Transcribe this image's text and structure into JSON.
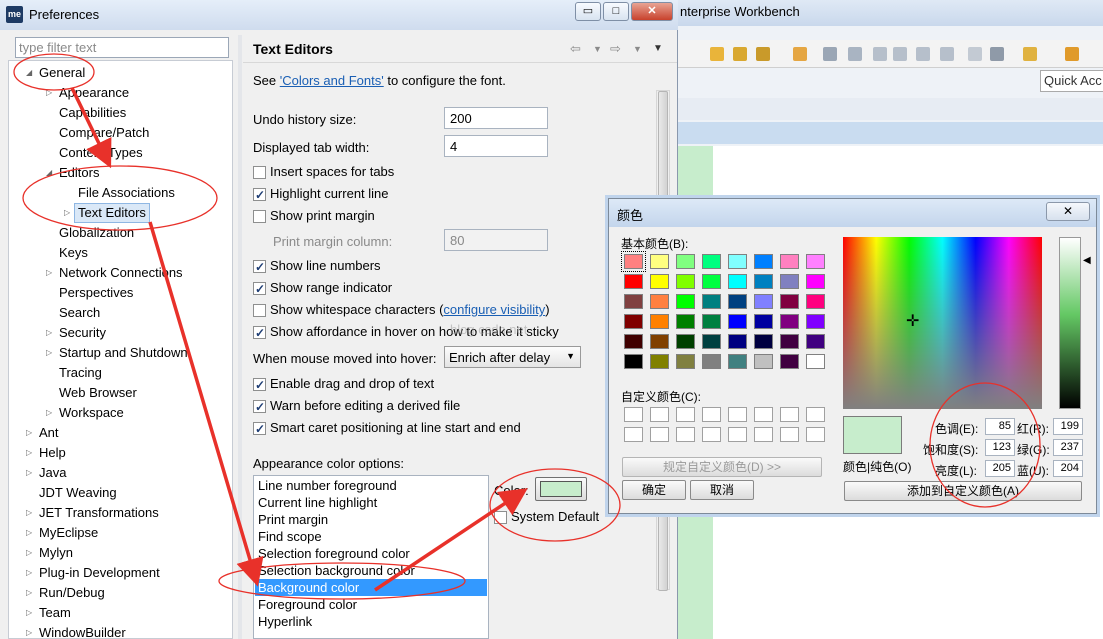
{
  "background": {
    "title": "nterprise Workbench",
    "quick_access": "Quick Acc"
  },
  "window": {
    "title": "Preferences",
    "filter_placeholder": "type filter text",
    "minimize": "▭",
    "maximize": "□",
    "close": "✕"
  },
  "tree": [
    {
      "label": "General",
      "level": 0,
      "expanded": true
    },
    {
      "label": "Appearance",
      "level": 1,
      "twisty": true
    },
    {
      "label": "Capabilities",
      "level": 1
    },
    {
      "label": "Compare/Patch",
      "level": 1
    },
    {
      "label": "Content Types",
      "level": 1
    },
    {
      "label": "Editors",
      "level": 1,
      "expanded": true
    },
    {
      "label": "File Associations",
      "level": 2
    },
    {
      "label": "Text Editors",
      "level": 2,
      "twisty": true,
      "selected": true
    },
    {
      "label": "Globalization",
      "level": 1
    },
    {
      "label": "Keys",
      "level": 1
    },
    {
      "label": "Network Connections",
      "level": 1,
      "twisty": true
    },
    {
      "label": "Perspectives",
      "level": 1
    },
    {
      "label": "Search",
      "level": 1
    },
    {
      "label": "Security",
      "level": 1,
      "twisty": true
    },
    {
      "label": "Startup and Shutdown",
      "level": 1,
      "twisty": true
    },
    {
      "label": "Tracing",
      "level": 1
    },
    {
      "label": "Web Browser",
      "level": 1
    },
    {
      "label": "Workspace",
      "level": 1,
      "twisty": true
    },
    {
      "label": "Ant",
      "level": 0,
      "twisty": true
    },
    {
      "label": "Help",
      "level": 0,
      "twisty": true
    },
    {
      "label": "Java",
      "level": 0,
      "twisty": true
    },
    {
      "label": "JDT Weaving",
      "level": 0
    },
    {
      "label": "JET Transformations",
      "level": 0,
      "twisty": true
    },
    {
      "label": "MyEclipse",
      "level": 0,
      "twisty": true
    },
    {
      "label": "Mylyn",
      "level": 0,
      "twisty": true
    },
    {
      "label": "Plug-in Development",
      "level": 0,
      "twisty": true
    },
    {
      "label": "Run/Debug",
      "level": 0,
      "twisty": true
    },
    {
      "label": "Team",
      "level": 0,
      "twisty": true
    },
    {
      "label": "WindowBuilder",
      "level": 0,
      "twisty": true
    }
  ],
  "page": {
    "title": "Text Editors",
    "see_prefix": "See ",
    "see_link": "'Colors and Fonts'",
    "see_suffix": " to configure the font.",
    "undo_label": "Undo history size:",
    "undo_value": "200",
    "tab_label": "Displayed tab width:",
    "tab_value": "4",
    "insert_spaces": "Insert spaces for tabs",
    "highlight_line": "Highlight current line",
    "show_print_margin": "Show print margin",
    "print_margin_label": "Print margin column:",
    "print_margin_value": "80",
    "show_line_numbers": "Show line numbers",
    "show_range": "Show range indicator",
    "show_whitespace": "Show whitespace characters (",
    "configure_visibility": "configure visibility",
    "close_paren": ")",
    "show_affordance": "Show affordance in hover on how to make it sticky",
    "hover_label": "When mouse moved into hover:",
    "hover_value": "Enrich after delay",
    "drag_drop": "Enable drag and drop of text",
    "warn_derived": "Warn before editing a derived file",
    "smart_caret": "Smart caret positioning at line start and end",
    "appearance_label": "Appearance color options:",
    "color_options": [
      "Line number foreground",
      "Current line highlight",
      "Print margin",
      "Find scope",
      "Selection foreground color",
      "Selection background color",
      "Background color",
      "Foreground color",
      "Hyperlink"
    ],
    "selected_option": "Background color",
    "color_label": "Color:",
    "color_value": "#c7edcc",
    "system_default": "System Default"
  },
  "color_dialog": {
    "title": "颜色",
    "basic_colors": "基本颜色(B):",
    "custom_colors": "自定义颜色(C):",
    "define_custom": "规定自定义颜色(D) >>",
    "ok": "确定",
    "cancel": "取消",
    "color_solid": "颜色|纯色(O)",
    "add_custom": "添加到自定义颜色(A)",
    "hue_label": "色调(E):",
    "hue": "85",
    "sat_label": "饱和度(S):",
    "sat": "123",
    "lum_label": "亮度(L):",
    "lum": "205",
    "red_label": "红(R):",
    "red": "199",
    "green_label": "绿(G):",
    "green": "237",
    "blue_label": "蓝(U):",
    "blue": "204",
    "current_color": "#c7edcc",
    "basic_palette": [
      "#ff8080",
      "#ffff80",
      "#80ff80",
      "#00ff80",
      "#80ffff",
      "#0080ff",
      "#ff80c0",
      "#ff80ff",
      "#ff0000",
      "#ffff00",
      "#80ff00",
      "#00ff40",
      "#00ffff",
      "#0080c0",
      "#8080c0",
      "#ff00ff",
      "#804040",
      "#ff8040",
      "#00ff00",
      "#008080",
      "#004080",
      "#8080ff",
      "#800040",
      "#ff0080",
      "#800000",
      "#ff8000",
      "#008000",
      "#008040",
      "#0000ff",
      "#0000a0",
      "#800080",
      "#8000ff",
      "#400000",
      "#804000",
      "#004000",
      "#004040",
      "#000080",
      "#000040",
      "#400040",
      "#400080",
      "#000000",
      "#808000",
      "#808040",
      "#808080",
      "#408080",
      "#c0c0c0",
      "#400040",
      "#ffffff"
    ]
  },
  "watermark": "blog.csdn.net"
}
